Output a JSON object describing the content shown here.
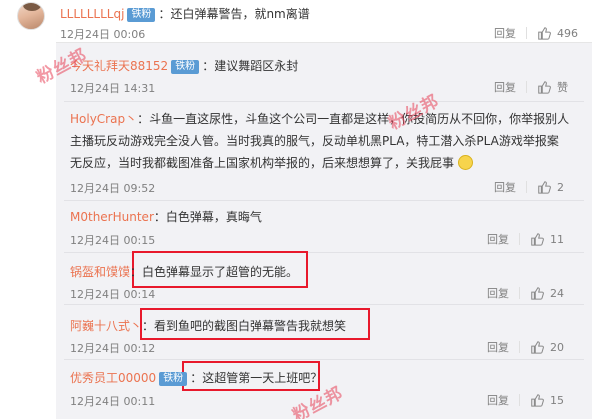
{
  "watermark": "粉丝邦",
  "main_comment": {
    "user": "LLLLLLLLqj",
    "badge": "铁粉",
    "text": "：还白弹幕警告，就nm离谱",
    "time": "12月24日 00:06",
    "reply_label": "回复",
    "likes": "496"
  },
  "replies": [
    {
      "user": "今天礼拜天88152",
      "badge": "铁粉",
      "text": "：建议舞蹈区永封",
      "time": "12月24日 14:31",
      "reply_label": "回复",
      "likes": "赞"
    },
    {
      "user": "HolyCrap丶",
      "badge": "",
      "text_line1": "：斗鱼一直这尿性，斗鱼这个公司一直都是这样，你投简历从不回你，你举报别人",
      "text_line2": "主播玩反动游戏完全没人管。当时我真的服气，反动单机黑PLA，特工潜入杀PLA游戏举报案",
      "text_line3": "无反应，当时我都截图准备上国家机构举报的，后来想想算了，关我屁事",
      "time": "12月24日 09:52",
      "reply_label": "回复",
      "likes": "2"
    },
    {
      "user": "M0therHunter",
      "badge": "",
      "text": "：白色弹幕，真晦气",
      "time": "12月24日 00:15",
      "reply_label": "回复",
      "likes": "11"
    },
    {
      "user": "锅盔和馍馍",
      "badge": "",
      "text": "：白色弹幕显示了超管的无能。",
      "time": "12月24日 00:14",
      "reply_label": "回复",
      "likes": "24"
    },
    {
      "user": "阿巍十八式丶",
      "badge": "",
      "text": "：看到鱼吧的截图白弹幕警告我就想笑",
      "time": "12月24日 00:12",
      "reply_label": "回复",
      "likes": "20"
    },
    {
      "user": "优秀员工00000",
      "badge": "铁粉",
      "text": "：这超管第一天上班吧？",
      "time": "12月24日 00:11",
      "reply_label": "回复",
      "likes": "15"
    }
  ],
  "colors": {
    "username": "#eb7350",
    "badge": "#5a9bd4",
    "highlight": "#e8192c",
    "watermark": "#e8455a"
  },
  "icons": {
    "like": "thumbs-up-icon",
    "emoji": "grin-emoji-icon"
  }
}
